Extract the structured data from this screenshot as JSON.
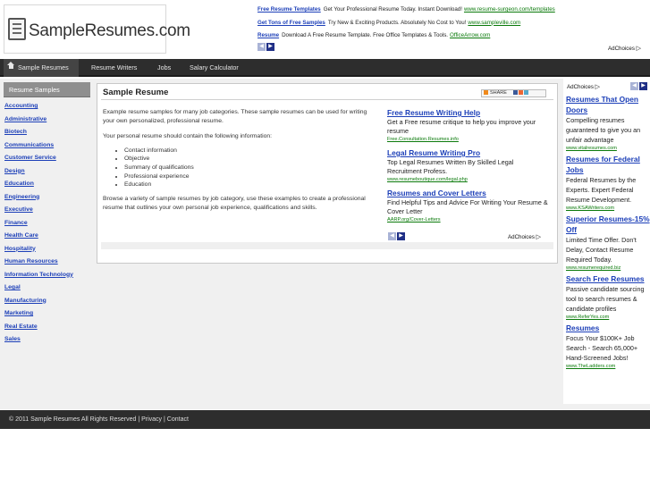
{
  "header": {
    "logo_text": "SampleResumes.com",
    "top_ads": [
      {
        "title": "Free Resume Templates",
        "text": "Get Your Professional Resume Today. Instant Download!",
        "url": "www.resume-surgeon.com/templates"
      },
      {
        "title": "Get Tons of Free Samples",
        "text": "Try New & Exciting Products. Absolutely No Cost to You!",
        "url": "www.sampleville.com"
      },
      {
        "title": "Resume",
        "text": "Download A Free Resume Template. Free Office Templates & Tools.",
        "url": "OfficeArrow.com"
      }
    ],
    "adchoices": "AdChoices"
  },
  "nav": {
    "items": [
      "Sample Resumes",
      "Resume Writers",
      "Jobs",
      "Salary Calculator"
    ]
  },
  "sidebar": {
    "heading": "Resume Samples",
    "items": [
      "Accounting",
      "Administrative",
      "Biotech",
      "Communications",
      "Customer Service",
      "Design",
      "Education",
      "Engineering",
      "Executive",
      "Finance",
      "Health Care",
      "Hospitality",
      "Human Resources",
      "Information Technology",
      "Legal",
      "Manufacturing",
      "Marketing",
      "Real Estate",
      "Sales"
    ]
  },
  "main": {
    "title": "Sample Resume",
    "share_label": "SHARE",
    "para1": "Example resume samples for many job categories. These sample resumes can be used for writing your own personalized, professional resume.",
    "para2": "Your personal resume should contain the following information:",
    "bullets": [
      "Contact information",
      "Objective",
      "Summary of qualifications",
      "Professional experience",
      "Education"
    ],
    "para3": "Browse a variety of sample resumes by job category, use these examples to create a professional resume that outlines your own personal job experience, qualifications and skills.",
    "ads": [
      {
        "title": "Free Resume Writing Help",
        "text": "Get a Free resume critique to help you improve your resume",
        "url": "Free.Consultation.Resumes.info"
      },
      {
        "title": "Legal Resume Writing Pro",
        "text": "Top Legal Resumes Written By Skilled Legal Recruitment Profess.",
        "url": "www.resumeboutique.com/legal.php"
      },
      {
        "title": "Resumes and Cover Letters",
        "text": "Find Helpful Tips and Advice For Writing Your Resume & Cover Letter",
        "url": "AARP.org/Cover-Letters"
      }
    ],
    "adchoices": "AdChoices"
  },
  "right_ads": {
    "adchoices": "AdChoices",
    "items": [
      {
        "title": "Resumes That Open Doors",
        "text": "Compelling resumes guaranteed to give you an unfair advantage",
        "url": "www.vitalresumes.com"
      },
      {
        "title": "Resumes for Federal Jobs",
        "text": "Federal Resumes by the Experts. Expert Federal Resume Development.",
        "url": "www.KSAWriters.com"
      },
      {
        "title": "Superior Resumes-15% Off",
        "text": "Limited Time Offer. Don't Delay, Contact Resume Required Today.",
        "url": "www.resumerequired.biz"
      },
      {
        "title": "Search Free Resumes",
        "text": "Passive candidate sourcing tool to search resumes & candidate profiles",
        "url": "www.ReferYes.com"
      },
      {
        "title": "Resumes",
        "text": "Focus Your $100K+ Job Search - Search 65,000+ Hand-Screened Jobs!",
        "url": "www.TheLadders.com"
      }
    ]
  },
  "footer": {
    "copyright": "© 2011 Sample Resumes All Rights Reserved",
    "sep": "|",
    "privacy": "Privacy",
    "contact": "Contact"
  },
  "colors": {
    "link": "#1c3fb8",
    "ad_url": "#0b7a0b",
    "nav_bg": "#2d2d2d"
  }
}
